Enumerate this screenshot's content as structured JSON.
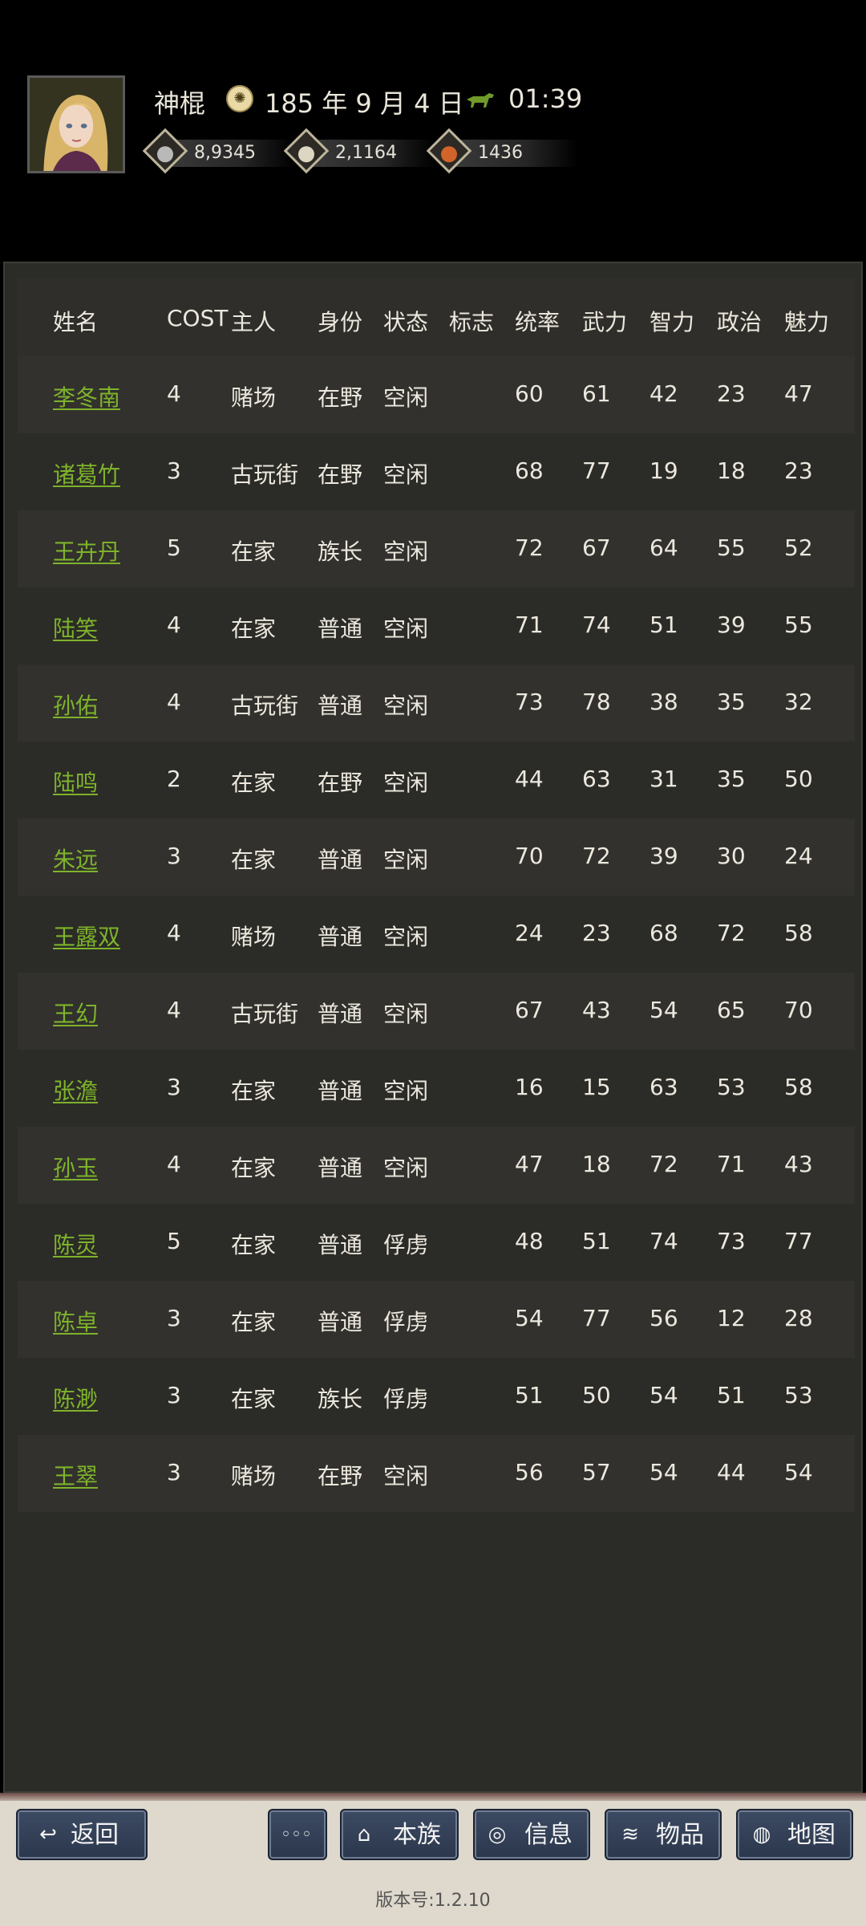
{
  "header": {
    "player_name": "神棍",
    "date": "185 年 9 月 4 日",
    "time": "01:39",
    "resources": [
      {
        "icon": "silver-coin-icon",
        "value": "8,9345",
        "color": "#b9b9b9"
      },
      {
        "icon": "rice-bowl-icon",
        "value": "2,1164",
        "color": "#dcd6c2"
      },
      {
        "icon": "food-icon",
        "value": "1436",
        "color": "#d2642a"
      }
    ]
  },
  "table": {
    "columns": [
      "姓名",
      "COST",
      "主人",
      "身份",
      "状态",
      "标志",
      "统率",
      "武力",
      "智力",
      "政治",
      "魅力"
    ],
    "rows": [
      {
        "name": "李冬南",
        "cost": "4",
        "owner": "赌场",
        "rank": "在野",
        "status": "空闲",
        "flag": "",
        "lead": "60",
        "war": "61",
        "int": "42",
        "pol": "23",
        "cha": "47"
      },
      {
        "name": "诸葛竹",
        "cost": "3",
        "owner": "古玩街",
        "rank": "在野",
        "status": "空闲",
        "flag": "",
        "lead": "68",
        "war": "77",
        "int": "19",
        "pol": "18",
        "cha": "23"
      },
      {
        "name": "王卉丹",
        "cost": "5",
        "owner": "在家",
        "rank": "族长",
        "status": "空闲",
        "flag": "",
        "lead": "72",
        "war": "67",
        "int": "64",
        "pol": "55",
        "cha": "52"
      },
      {
        "name": "陆笑",
        "cost": "4",
        "owner": "在家",
        "rank": "普通",
        "status": "空闲",
        "flag": "",
        "lead": "71",
        "war": "74",
        "int": "51",
        "pol": "39",
        "cha": "55"
      },
      {
        "name": "孙佑",
        "cost": "4",
        "owner": "古玩街",
        "rank": "普通",
        "status": "空闲",
        "flag": "",
        "lead": "73",
        "war": "78",
        "int": "38",
        "pol": "35",
        "cha": "32"
      },
      {
        "name": "陆鸣",
        "cost": "2",
        "owner": "在家",
        "rank": "在野",
        "status": "空闲",
        "flag": "",
        "lead": "44",
        "war": "63",
        "int": "31",
        "pol": "35",
        "cha": "50"
      },
      {
        "name": "朱远",
        "cost": "3",
        "owner": "在家",
        "rank": "普通",
        "status": "空闲",
        "flag": "",
        "lead": "70",
        "war": "72",
        "int": "39",
        "pol": "30",
        "cha": "24"
      },
      {
        "name": "王露双",
        "cost": "4",
        "owner": "赌场",
        "rank": "普通",
        "status": "空闲",
        "flag": "",
        "lead": "24",
        "war": "23",
        "int": "68",
        "pol": "72",
        "cha": "58"
      },
      {
        "name": "王幻",
        "cost": "4",
        "owner": "古玩街",
        "rank": "普通",
        "status": "空闲",
        "flag": "",
        "lead": "67",
        "war": "43",
        "int": "54",
        "pol": "65",
        "cha": "70"
      },
      {
        "name": "张澹",
        "cost": "3",
        "owner": "在家",
        "rank": "普通",
        "status": "空闲",
        "flag": "",
        "lead": "16",
        "war": "15",
        "int": "63",
        "pol": "53",
        "cha": "58"
      },
      {
        "name": "孙玉",
        "cost": "4",
        "owner": "在家",
        "rank": "普通",
        "status": "空闲",
        "flag": "",
        "lead": "47",
        "war": "18",
        "int": "72",
        "pol": "71",
        "cha": "43"
      },
      {
        "name": "陈灵",
        "cost": "5",
        "owner": "在家",
        "rank": "普通",
        "status": "俘虏",
        "flag": "",
        "lead": "48",
        "war": "51",
        "int": "74",
        "pol": "73",
        "cha": "77"
      },
      {
        "name": "陈卓",
        "cost": "3",
        "owner": "在家",
        "rank": "普通",
        "status": "俘虏",
        "flag": "",
        "lead": "54",
        "war": "77",
        "int": "56",
        "pol": "12",
        "cha": "28"
      },
      {
        "name": "陈渺",
        "cost": "3",
        "owner": "在家",
        "rank": "族长",
        "status": "俘虏",
        "flag": "",
        "lead": "51",
        "war": "50",
        "int": "54",
        "pol": "51",
        "cha": "53"
      },
      {
        "name": "王翠",
        "cost": "3",
        "owner": "赌场",
        "rank": "在野",
        "status": "空闲",
        "flag": "",
        "lead": "56",
        "war": "57",
        "int": "54",
        "pol": "44",
        "cha": "54"
      }
    ]
  },
  "nav": {
    "back": "返回",
    "more": "◦◦◦",
    "clan": "本族",
    "info": "信息",
    "items": "物品",
    "map": "地图"
  },
  "version": "版本号:1.2.10",
  "colors": {
    "name_link": "#7eb32b",
    "panel_bg": "#2b2b27",
    "button_bg": "#33405a"
  }
}
